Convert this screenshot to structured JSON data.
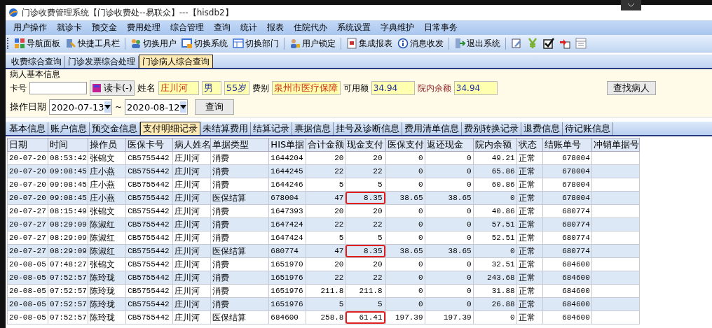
{
  "window": {
    "title": "门诊收费管理系统【门诊收费处--易联众】---【hisdb2】"
  },
  "menu": [
    "用户操作",
    "就诊卡",
    "预交金",
    "费用处理",
    "综合管理",
    "查询",
    "统计",
    "报表",
    "住院代办",
    "系统设置",
    "字典维护",
    "日常事务"
  ],
  "toolbar": [
    {
      "kind": "button",
      "label": "导航面板"
    },
    {
      "kind": "button",
      "label": "快捷工具栏"
    },
    {
      "kind": "separator"
    },
    {
      "kind": "button",
      "label": "切换用户"
    },
    {
      "kind": "button",
      "label": "切换系统"
    },
    {
      "kind": "button",
      "label": "切换部门"
    },
    {
      "kind": "separator"
    },
    {
      "kind": "button",
      "label": "用户锁定"
    },
    {
      "kind": "separator"
    },
    {
      "kind": "button",
      "label": "集成报表"
    },
    {
      "kind": "button",
      "label": "消息收发"
    },
    {
      "kind": "separator"
    },
    {
      "kind": "button",
      "label": "退出系统"
    },
    {
      "kind": "separator"
    },
    {
      "kind": "icon_button"
    },
    {
      "kind": "icon_button"
    },
    {
      "kind": "icon_button"
    },
    {
      "kind": "icon_button"
    },
    {
      "kind": "icon_button"
    }
  ],
  "tabs": [
    {
      "label": "收费综合查询",
      "selected": false
    },
    {
      "label": "门诊发票综合处理",
      "selected": false
    },
    {
      "label": "门诊病人综合查询",
      "selected": true
    }
  ],
  "patient_panel": {
    "title": "病人基本信息",
    "card_label": "卡号",
    "read_card_button": "读卡(-)",
    "name_label": "姓名",
    "name": "庄川河",
    "gender": "男",
    "age": "55岁",
    "fee_type_label": "费别",
    "fee_type": "泉州市医疗保障",
    "available_label": "可用额",
    "available": "34.94",
    "balance_label": "院内余额",
    "balance": "34.94",
    "find_button": "查找病人"
  },
  "date_filter": {
    "label": "操作日期",
    "from": "2020-07-13",
    "separator": "~",
    "to": "2020-08-12",
    "query_button": "查询"
  },
  "detail_tabs": [
    {
      "label": "基本信息",
      "selected": false
    },
    {
      "label": "账户信息",
      "selected": false
    },
    {
      "label": "预交金信息",
      "selected": false
    },
    {
      "label": "支付明细记录",
      "selected": true
    },
    {
      "label": "未结算费用",
      "selected": false
    },
    {
      "label": "结算记录",
      "selected": false
    },
    {
      "label": "票据信息",
      "selected": false
    },
    {
      "label": "挂号及诊断信息",
      "selected": false
    },
    {
      "label": "费用清单信息",
      "selected": false
    },
    {
      "label": "费别转换记录",
      "selected": false
    },
    {
      "label": "退费信息",
      "selected": false
    },
    {
      "label": "待记账信息",
      "selected": false
    }
  ],
  "table": {
    "columns": [
      "日期",
      "时间",
      "操作员",
      "医保卡号",
      "病人姓名",
      "单据类型",
      "HIS单据",
      "合计金额",
      "现金支付",
      "医保支付",
      "返还现金",
      "院内余额",
      "状态",
      "结账单号",
      "冲销单据号"
    ],
    "rows": [
      {
        "highlighted": false,
        "cells": [
          "20-07-20",
          "08:53:42",
          "张锦文",
          "CB5755442",
          "庄川河",
          "消费",
          "1644204",
          "20",
          "20",
          "0",
          "0",
          "49.21",
          "正常",
          "678004"
        ]
      },
      {
        "highlighted": false,
        "cells": [
          "20-07-20",
          "09:08:45",
          "庄小燕",
          "CB5755442",
          "庄川河",
          "消费",
          "1644245",
          "22",
          "22",
          "0",
          "0",
          "65.86",
          "正常",
          "678004"
        ]
      },
      {
        "highlighted": false,
        "cells": [
          "20-07-20",
          "09:08:45",
          "庄小燕",
          "CB5755442",
          "庄川河",
          "消费",
          "1644246",
          "5",
          "5",
          "0",
          "0",
          "60.86",
          "正常",
          "678004"
        ]
      },
      {
        "highlighted": true,
        "cells": [
          "20-07-20",
          "09:08:45",
          "庄小燕",
          "CB5755442",
          "庄川河",
          "医保结算",
          "678004",
          "47",
          "8.35",
          "38.65",
          "38.65",
          "0",
          "正常",
          "678004"
        ]
      },
      {
        "highlighted": false,
        "cells": [
          "20-07-27",
          "08:15:49",
          "张锦文",
          "CB5755442",
          "庄川河",
          "消费",
          "1647393",
          "20",
          "20",
          "0",
          "0",
          "40.86",
          "正常",
          "680774"
        ]
      },
      {
        "highlighted": false,
        "cells": [
          "20-07-27",
          "08:29:09",
          "陈淑红",
          "CB5755442",
          "庄川河",
          "消费",
          "1647424",
          "22",
          "22",
          "0",
          "0",
          "57.51",
          "正常",
          "680774"
        ]
      },
      {
        "highlighted": false,
        "cells": [
          "20-07-27",
          "08:29:09",
          "陈淑红",
          "CB5755442",
          "庄川河",
          "消费",
          "1647424",
          "5",
          "5",
          "0",
          "0",
          "52.51",
          "正常",
          "680774"
        ]
      },
      {
        "highlighted": true,
        "cells": [
          "20-07-27",
          "08:29:09",
          "陈淑红",
          "CB5755442",
          "庄川河",
          "医保结算",
          "680774",
          "47",
          "8.35",
          "38.65",
          "38.65",
          "0",
          "正常",
          "680774"
        ]
      },
      {
        "highlighted": false,
        "cells": [
          "20-08-05",
          "07:48:27",
          "张锦文",
          "CB5755442",
          "庄川河",
          "消费",
          "1651970",
          "20",
          "20",
          "0",
          "0",
          "32.51",
          "正常",
          "684600"
        ]
      },
      {
        "highlighted": false,
        "cells": [
          "20-08-05",
          "07:52:57",
          "陈玲珑",
          "CB5755442",
          "庄川河",
          "消费",
          "1651976",
          "22",
          "22",
          "0",
          "0",
          "243.68",
          "正常",
          "684600"
        ]
      },
      {
        "highlighted": false,
        "cells": [
          "20-08-05",
          "07:52:57",
          "陈玲珑",
          "CB5755442",
          "庄川河",
          "消费",
          "1651976",
          "211.8",
          "211.8",
          "0",
          "0",
          "31.88",
          "正常",
          "684600"
        ]
      },
      {
        "highlighted": false,
        "cells": [
          "20-08-05",
          "07:52:57",
          "陈玲珑",
          "CB5755442",
          "庄川河",
          "消费",
          "1651976",
          "5",
          "5",
          "0",
          "0",
          "26.88",
          "正常",
          "684600"
        ]
      },
      {
        "highlighted": true,
        "cells": [
          "20-08-05",
          "07:52:57",
          "陈玲珑",
          "CB5755442",
          "庄川河",
          "医保结算",
          "684600",
          "258.8",
          "61.41",
          "197.39",
          "197.39",
          "0",
          "正常",
          "684600"
        ]
      }
    ]
  }
}
